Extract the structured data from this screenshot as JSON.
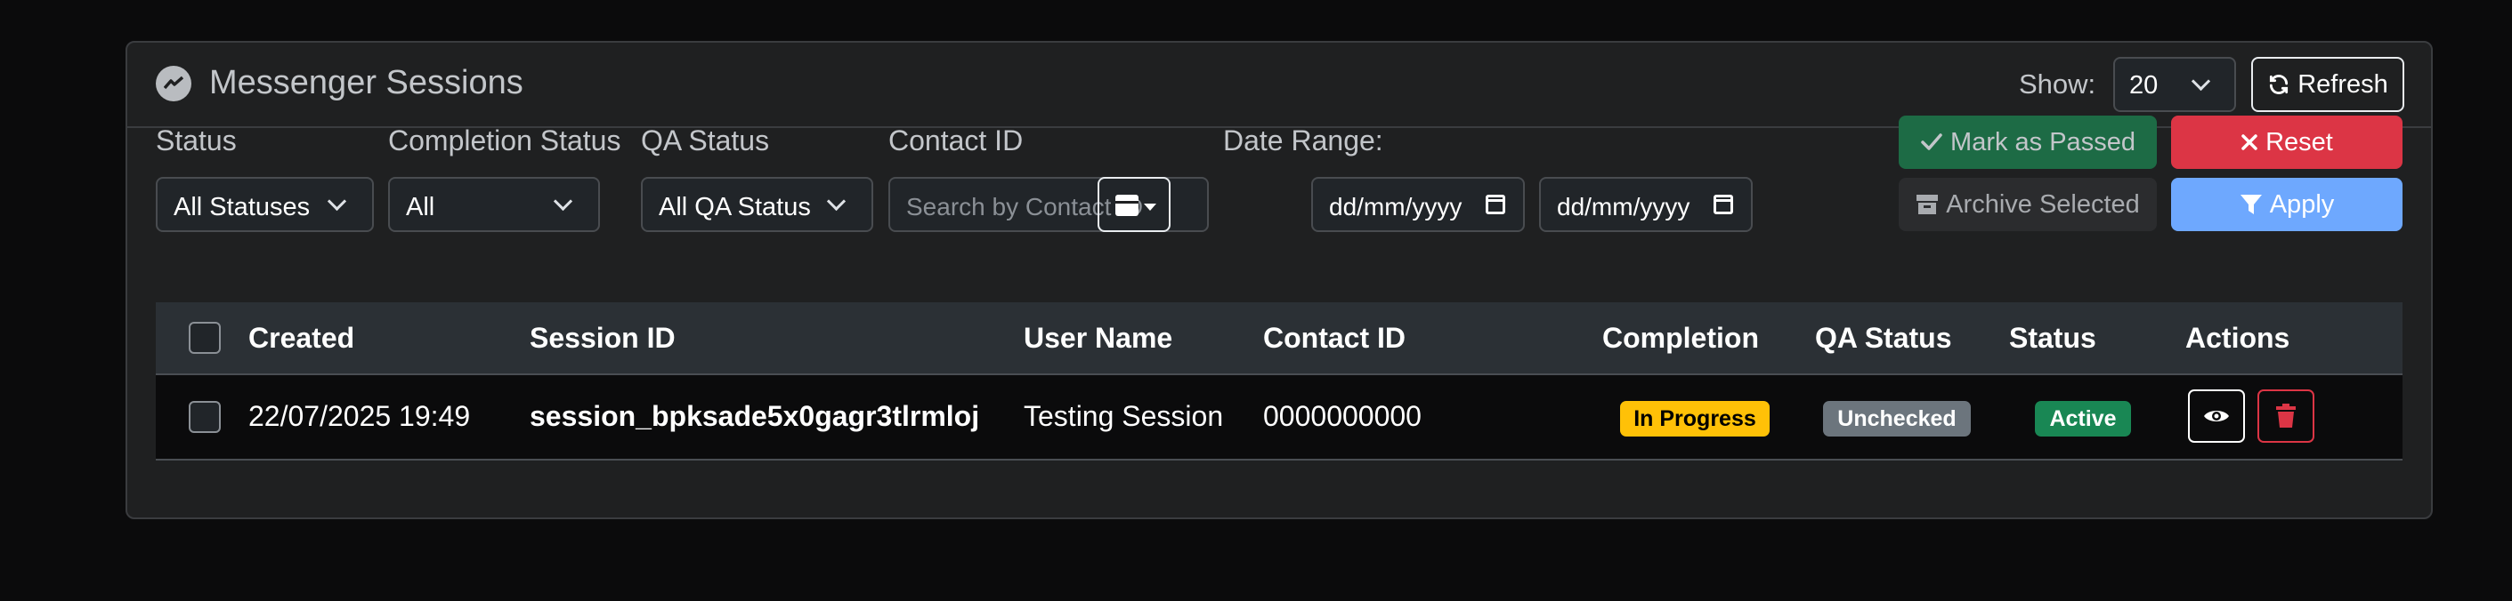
{
  "header": {
    "title": "Messenger Sessions",
    "show_label": "Show:",
    "show_value": "20",
    "refresh_label": "Refresh"
  },
  "filters": {
    "status": {
      "label": "Status",
      "value": "All Statuses"
    },
    "completion": {
      "label": "Completion Status",
      "value": "All"
    },
    "qa": {
      "label": "QA Status",
      "value": "All QA Status"
    },
    "contact": {
      "label": "Contact ID",
      "placeholder": "Search by Contact ID"
    },
    "date": {
      "label": "Date Range:",
      "from": "dd/mm/yyyy",
      "to": "dd/mm/yyyy"
    }
  },
  "actions": {
    "mark_passed": "Mark as Passed",
    "reset": "Reset",
    "archive": "Archive Selected",
    "apply": "Apply"
  },
  "table": {
    "columns": [
      "Created",
      "Session ID",
      "User Name",
      "Contact ID",
      "Completion",
      "QA Status",
      "Status",
      "Actions"
    ],
    "rows": [
      {
        "created": "22/07/2025 19:49",
        "session_id": "session_bpksade5x0gagr3tlrmloj",
        "user_name": "Testing Session",
        "contact_id": "0000000000",
        "completion": "In Progress",
        "qa_status": "Unchecked",
        "status": "Active"
      }
    ]
  },
  "colors": {
    "accent_blue": "#6ea8fe",
    "success": "#198754",
    "danger": "#dc3545",
    "warning": "#ffc107",
    "secondary": "#6c757d"
  },
  "icons": [
    "messenger-icon",
    "refresh-icon",
    "chevron-down-icon",
    "calendar-icon",
    "check-icon",
    "x-icon",
    "archive-icon",
    "filter-icon",
    "eye-icon",
    "trash-icon"
  ]
}
